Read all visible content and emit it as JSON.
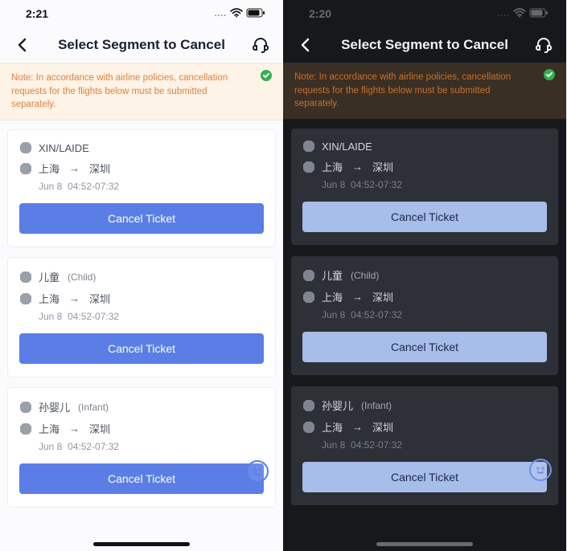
{
  "screens": {
    "light": {
      "status_time": "2:21",
      "nav_title": "Select Segment to Cancel"
    },
    "dark": {
      "status_time": "2:20",
      "nav_title": "Select Segment to Cancel"
    }
  },
  "note": "Note: In accordance with airline policies, cancellation requests for the flights below must be submitted separately.",
  "button_label": "Cancel Ticket",
  "passengers": [
    {
      "name": "XIN/LAIDE",
      "type": "",
      "from": "上海",
      "to": "深圳",
      "date": "Jun 8",
      "time": "04:52-07:32"
    },
    {
      "name": "儿童",
      "type": "(Child)",
      "from": "上海",
      "to": "深圳",
      "date": "Jun 8",
      "time": "04:52-07:32"
    },
    {
      "name": "孙婴儿",
      "type": "(Infant)",
      "from": "上海",
      "to": "深圳",
      "date": "Jun 8",
      "time": "04:52-07:32"
    }
  ]
}
